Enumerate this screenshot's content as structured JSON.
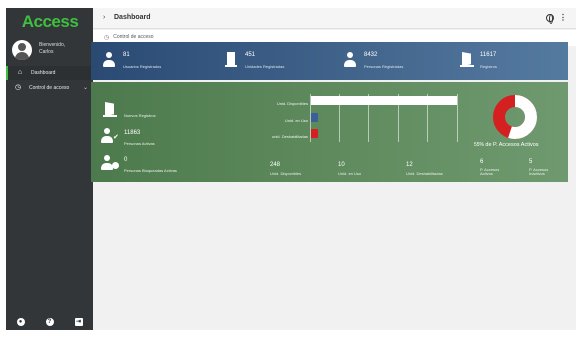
{
  "app": {
    "logo": "Access"
  },
  "user": {
    "line1": "Bienvenido,",
    "line2": "Carlos"
  },
  "sidebar": {
    "items": [
      {
        "label": "Dashboard",
        "icon": "home-icon"
      },
      {
        "label": "Control de acceso",
        "icon": "clock-icon"
      }
    ]
  },
  "topbar": {
    "arrow": "›",
    "title": "Dashboard"
  },
  "tab": {
    "label": "Control de acceso"
  },
  "stats_blue": [
    {
      "value": "81",
      "label": "Usuarios Registrados",
      "icon": "user-icon"
    },
    {
      "value": "451",
      "label": "Unidades Registradas",
      "icon": "door-icon"
    },
    {
      "value": "8432",
      "label": "Personas Registradas",
      "icon": "person-icon"
    },
    {
      "value": "11617",
      "label": "Registros",
      "icon": "door-open-icon"
    }
  ],
  "stats_green": [
    {
      "value": "",
      "label": "Nuevos Registros",
      "icon": "door-open-icon"
    },
    {
      "value": "11863",
      "label": "Personas Activas",
      "icon": "user-check-icon"
    },
    {
      "value": "0",
      "label": "Personas Bloqueadas Activas",
      "icon": "user-clock-icon"
    }
  ],
  "chart_data": {
    "type": "bar",
    "orientation": "horizontal",
    "categories": [
      "Unid. Disponibles",
      "Unid. en Uso",
      "unid. Deshabilitadas"
    ],
    "values": [
      248,
      10,
      12
    ],
    "colors": [
      "#ffffff",
      "#3a5f99",
      "#d42020"
    ],
    "xlim": [
      0,
      248
    ],
    "grid": true
  },
  "bottom_stats": [
    {
      "value": "248",
      "label": "Unid. Disponibles"
    },
    {
      "value": "10",
      "label": "Unid. en Uso"
    },
    {
      "value": "12",
      "label": "Unid. Deshabilitadas"
    },
    {
      "value": "6",
      "label": "P. Accesos Activos"
    },
    {
      "value": "5",
      "label": "P. Accesos Inactivos"
    }
  ],
  "pie": {
    "percent": "55%",
    "label": "de P. Accesos Activos",
    "active_fraction": 0.55,
    "colors": {
      "active": "#ffffff",
      "inactive": "#d42020"
    }
  },
  "colors": {
    "accent": "#3fbf3f",
    "sidebar": "#333638",
    "blue_panel": "#2a4a73",
    "green_panel": "#4d7a4d"
  }
}
